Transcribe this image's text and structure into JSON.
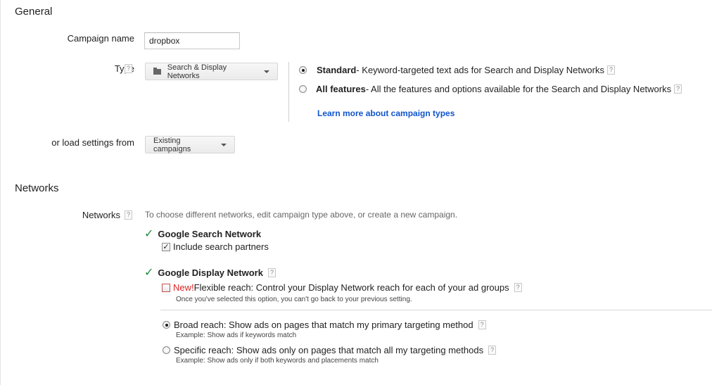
{
  "general": {
    "title": "General",
    "campaign_name_label": "Campaign name",
    "campaign_name_value": "dropbox",
    "type_label": "Type",
    "type_dropdown": "Search & Display Networks",
    "options": [
      {
        "title": "Standard",
        "desc": " - Keyword-targeted text ads for Search and Display Networks",
        "selected": true
      },
      {
        "title": "All features",
        "desc": " - All the features and options available for the Search and Display Networks",
        "selected": false
      }
    ],
    "learn_more": "Learn more about campaign types",
    "load_label": "or load settings from",
    "load_dropdown": "Existing campaigns"
  },
  "networks": {
    "title": "Networks",
    "label": "Networks",
    "hint": "To choose different networks, edit campaign type above, or create a new campaign.",
    "search_network": "Google Search Network",
    "include_partners": "Include search partners",
    "display_network": "Google Display Network",
    "new_label": "New!",
    "flexible_reach": " Flexible reach: Control your Display Network reach for each of your ad groups",
    "flexible_note": "Once you've selected this option, you can't go back to your previous setting.",
    "broad_reach": "Broad reach: Show ads on pages that match my primary targeting method",
    "broad_example": "Example: Show ads if keywords match",
    "specific_reach": "Specific reach: Show ads only on pages that match all my targeting methods",
    "specific_example": "Example: Show ads only if both keywords and placements match"
  },
  "help_glyph": "?",
  "check_glyph": "✓"
}
